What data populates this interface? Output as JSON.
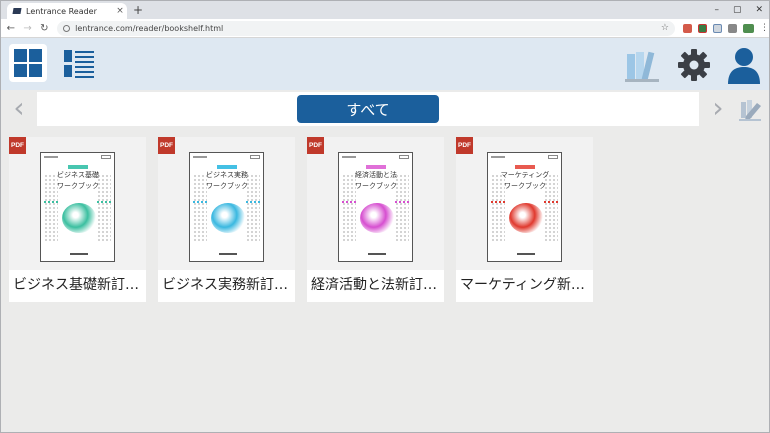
{
  "browser": {
    "tab_title": "Lentrance Reader",
    "tab_close": "×",
    "new_tab": "+",
    "url": "lentrance.com/reader/bookshelf.html",
    "controls": [
      "–",
      "▢",
      "✕"
    ]
  },
  "category": {
    "label": "すべて"
  },
  "books": [
    {
      "badge": "PDF",
      "title": "ビジネス基礎新訂…",
      "cover_title_1": "ビジネス基礎",
      "cover_title_2": "ワークブック",
      "accent": "#3bbfa0",
      "ribbon": "#48c6b0"
    },
    {
      "badge": "PDF",
      "title": "ビジネス実務新訂…",
      "cover_title_1": "ビジネス実務",
      "cover_title_2": "ワークブック",
      "accent": "#3ab8e0",
      "ribbon": "#44c0e4"
    },
    {
      "badge": "PDF",
      "title": "経済活動と法新訂…",
      "cover_title_1": "経済活動と法",
      "cover_title_2": "ワークブック",
      "accent": "#d64fd0",
      "ribbon": "#e070d8"
    },
    {
      "badge": "PDF",
      "title": "マーケティング新…",
      "cover_title_1": "マーケティング",
      "cover_title_2": "ワークブック",
      "accent": "#e0392e",
      "ribbon": "#e85a50"
    }
  ],
  "colors": {
    "brand": "#1b5f9c",
    "header_bg": "#dee8f2",
    "pdf_badge": "#c0392b"
  },
  "icons": {
    "grid_view": "grid-view-icon",
    "list_view": "list-view-icon",
    "bookshelf": "books-icon",
    "settings": "gear-icon",
    "account": "user-icon",
    "edit": "edit-icon"
  }
}
